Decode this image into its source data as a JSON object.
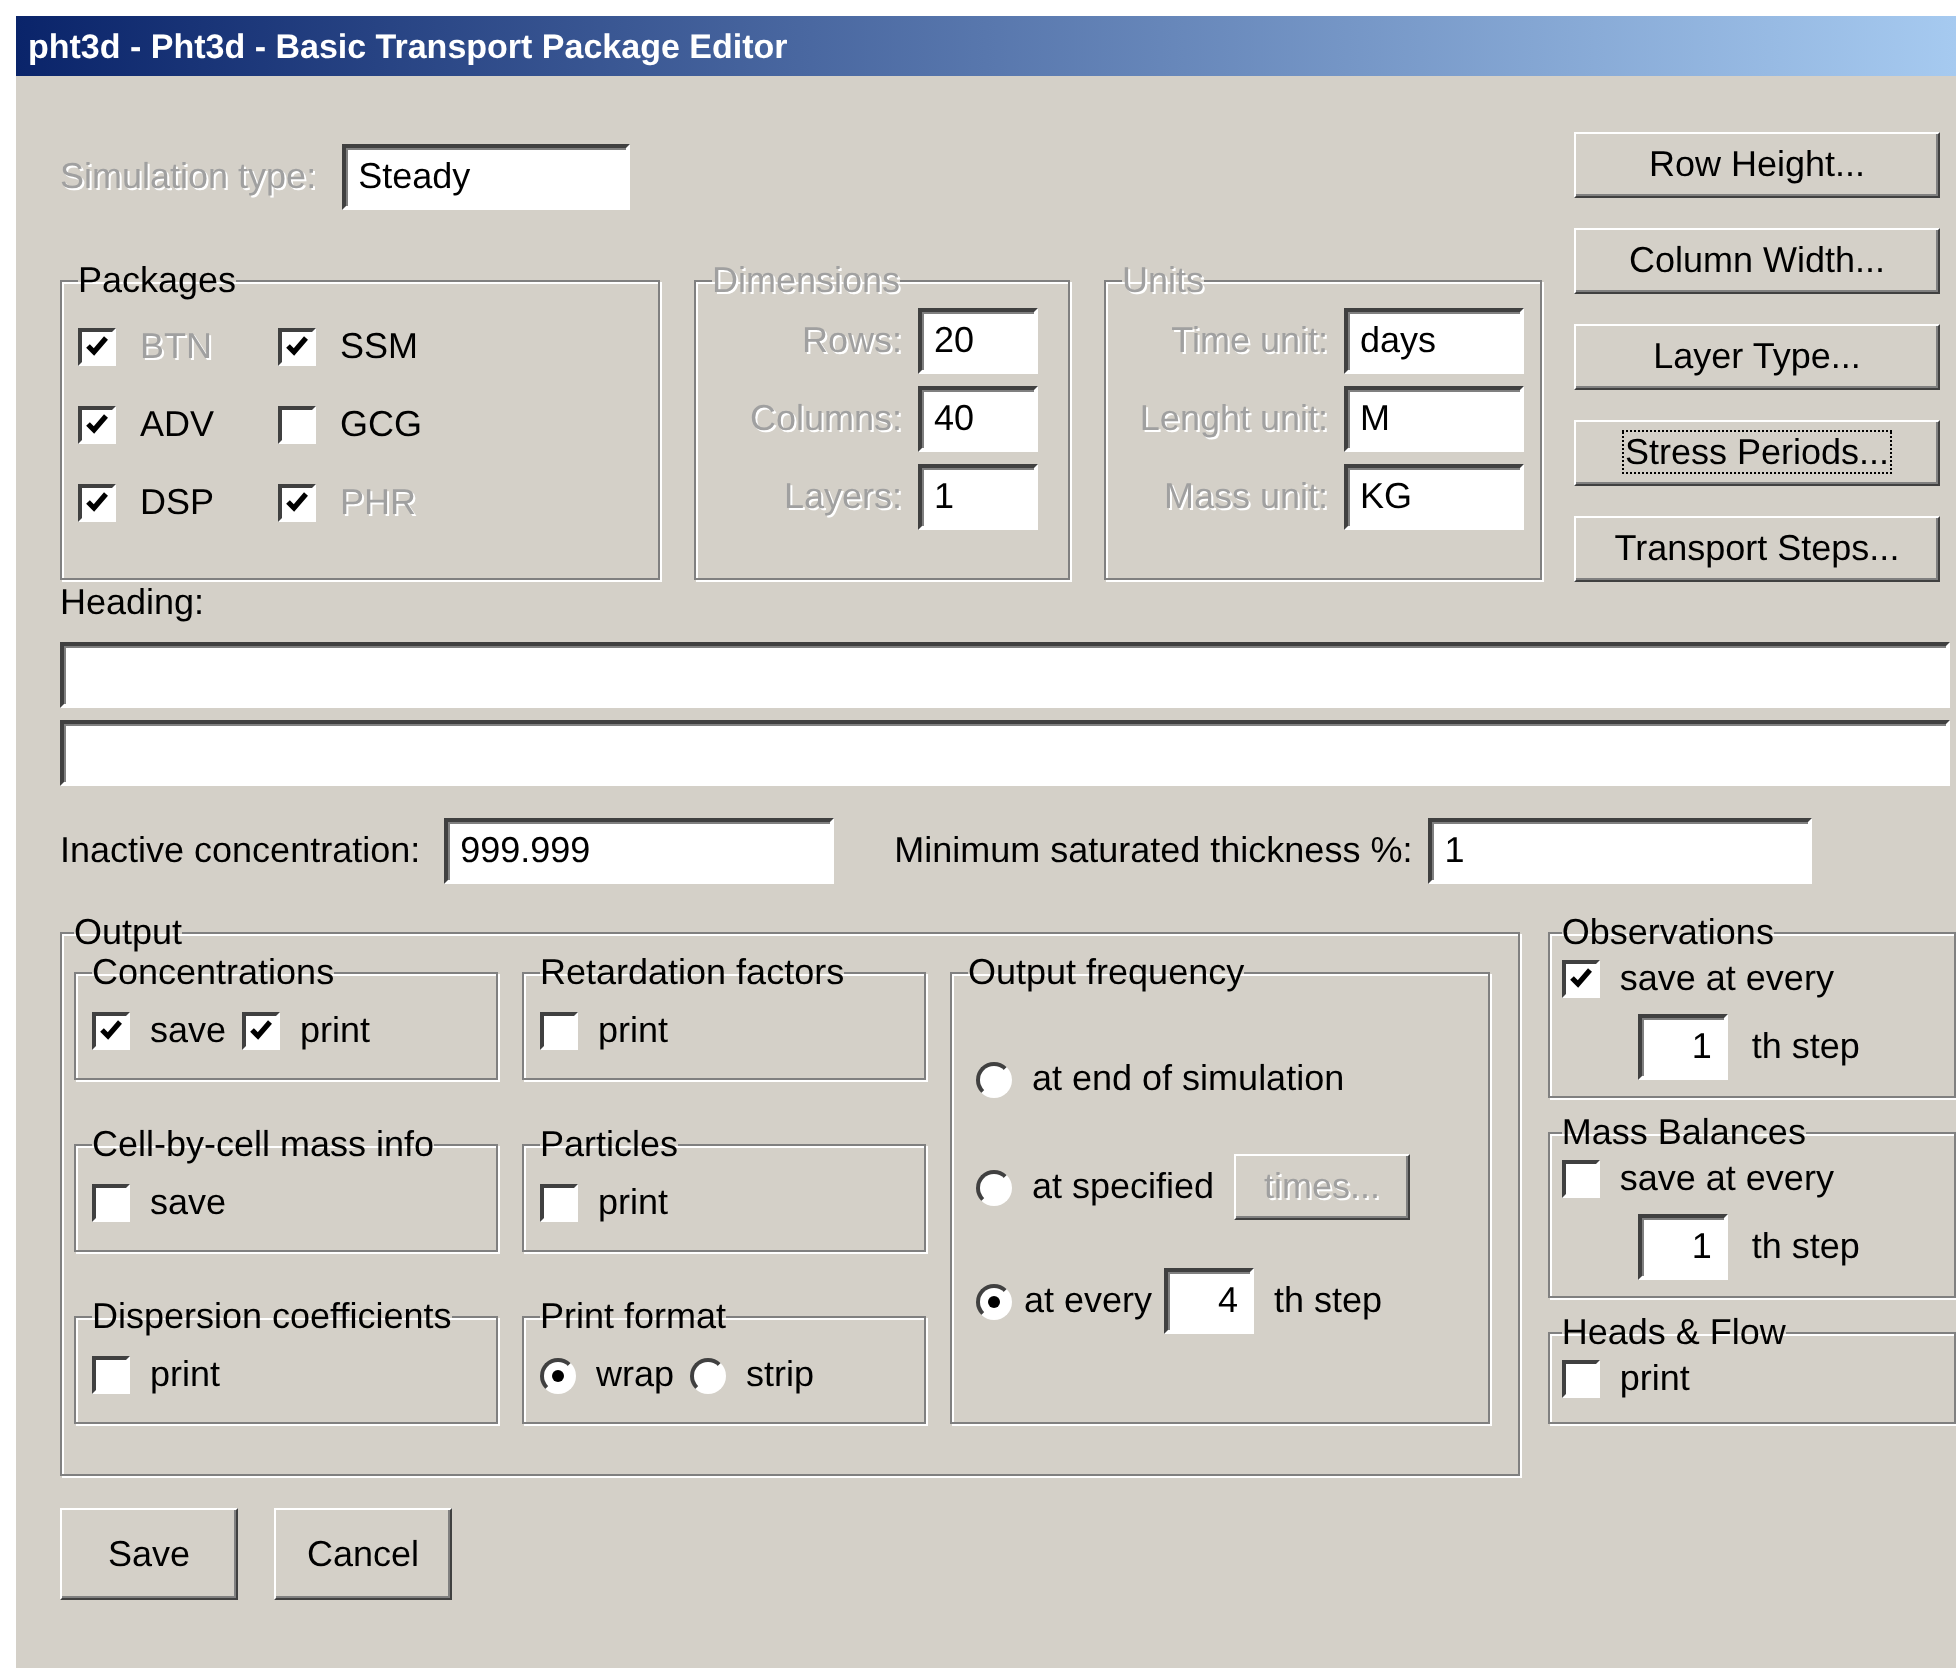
{
  "window": {
    "title": "pht3d - Pht3d - Basic Transport Package Editor"
  },
  "simulation_type": {
    "label": "Simulation type:",
    "value": "Steady",
    "disabled": true
  },
  "side_buttons": [
    {
      "label": "Row Height...",
      "focused": false
    },
    {
      "label": "Column Width...",
      "focused": false
    },
    {
      "label": "Layer Type...",
      "focused": false
    },
    {
      "label": "Stress Periods...",
      "focused": true
    },
    {
      "label": "Transport Steps...",
      "focused": false
    }
  ],
  "packages": {
    "title": "Packages",
    "items": [
      {
        "label": "BTN",
        "checked": true,
        "disabled": true
      },
      {
        "label": "SSM",
        "checked": true,
        "disabled": false
      },
      {
        "label": "ADV",
        "checked": true,
        "disabled": false
      },
      {
        "label": "GCG",
        "checked": false,
        "disabled": false
      },
      {
        "label": "DSP",
        "checked": true,
        "disabled": false
      },
      {
        "label": "PHR",
        "checked": true,
        "disabled": true
      }
    ]
  },
  "dimensions": {
    "title": "Dimensions",
    "disabled": true,
    "fields": [
      {
        "label": "Rows:",
        "value": "20"
      },
      {
        "label": "Columns:",
        "value": "40"
      },
      {
        "label": "Layers:",
        "value": "1"
      }
    ]
  },
  "units": {
    "title": "Units",
    "disabled": true,
    "fields": [
      {
        "label": "Time unit:",
        "value": "days"
      },
      {
        "label": "Lenght unit:",
        "value": "M"
      },
      {
        "label": "Mass unit:",
        "value": "KG"
      }
    ]
  },
  "heading": {
    "label": "Heading:"
  },
  "inactive_concentration": {
    "label": "Inactive concentration:",
    "value": "999.999"
  },
  "minimum_saturated_thickness": {
    "label": "Minimum saturated thickness %:",
    "value": "1"
  },
  "output": {
    "title": "Output",
    "groups": [
      {
        "title": "Concentrations",
        "items": [
          {
            "kind": "checkbox",
            "label": "save",
            "checked": true
          },
          {
            "kind": "checkbox",
            "label": "print",
            "checked": true
          }
        ]
      },
      {
        "title": "Retardation factors",
        "items": [
          {
            "kind": "checkbox",
            "label": "print",
            "checked": false
          }
        ]
      },
      {
        "title": "Cell-by-cell mass info",
        "items": [
          {
            "kind": "checkbox",
            "label": "save",
            "checked": false
          }
        ]
      },
      {
        "title": "Particles",
        "items": [
          {
            "kind": "checkbox",
            "label": "print",
            "checked": false
          }
        ]
      },
      {
        "title": "Dispersion coefficients",
        "items": [
          {
            "kind": "checkbox",
            "label": "print",
            "checked": false
          }
        ]
      },
      {
        "title": "Print format",
        "items": [
          {
            "kind": "radio",
            "label": "wrap",
            "selected": true
          },
          {
            "kind": "radio",
            "label": "strip",
            "selected": false
          }
        ]
      }
    ],
    "frequency": {
      "title": "Output frequency",
      "options": [
        {
          "kind": "plain",
          "label": "at end of simulation",
          "selected": false
        },
        {
          "kind": "button",
          "label": "at specified",
          "selected": false,
          "button": "times...",
          "button_disabled": true
        },
        {
          "kind": "step",
          "label": "at every",
          "selected": true,
          "value": "4",
          "suffix": "th step"
        }
      ]
    }
  },
  "side_groups": [
    {
      "title": "Observations",
      "checkbox": {
        "label": "save at  every",
        "checked": true
      },
      "step": {
        "value": "1",
        "suffix": "th step"
      }
    },
    {
      "title": "Mass Balances",
      "checkbox": {
        "label": "save at every",
        "checked": false
      },
      "step": {
        "value": "1",
        "suffix": "th step"
      }
    },
    {
      "title": "Heads & Flow",
      "checkbox": {
        "label": "print",
        "checked": false
      }
    }
  ],
  "buttons": [
    {
      "label": "Save"
    },
    {
      "label": "Cancel"
    }
  ]
}
